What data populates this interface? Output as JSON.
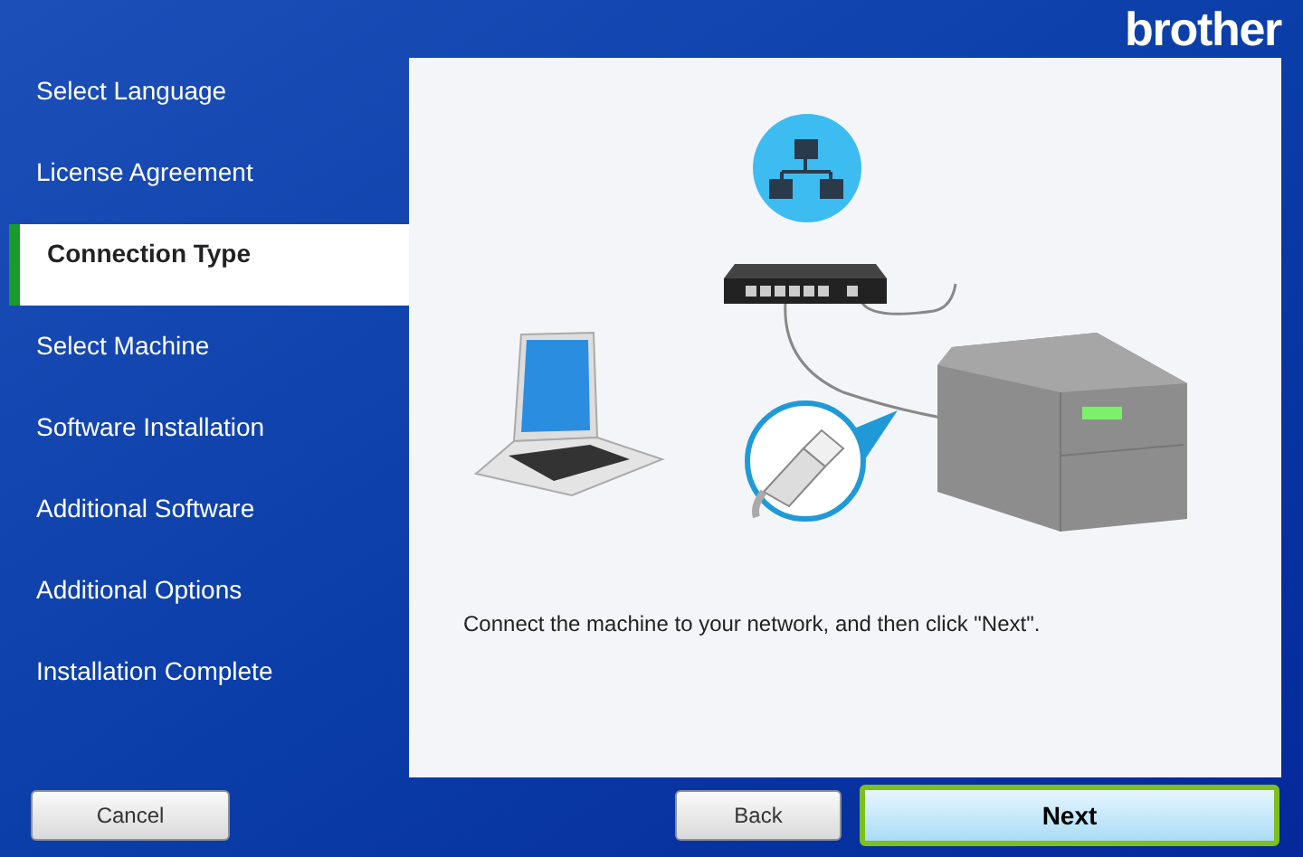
{
  "logo": "brother",
  "steps": [
    {
      "label": "Select Language",
      "selected": false
    },
    {
      "label": "License Agreement",
      "selected": false
    },
    {
      "label": "Connection Type",
      "selected": true
    },
    {
      "label": "Select Machine",
      "selected": false
    },
    {
      "label": "Software Installation",
      "selected": false
    },
    {
      "label": "Additional Software",
      "selected": false
    },
    {
      "label": "Additional Options",
      "selected": false
    },
    {
      "label": "Installation Complete",
      "selected": false
    }
  ],
  "instruction": "Connect the machine to your network, and then click \"Next\".",
  "buttons": [
    {
      "label": "Cancel",
      "kind": "cancel",
      "focused": false
    },
    {
      "label": "Back",
      "kind": "back",
      "focused": false
    },
    {
      "label": "Next",
      "kind": "next",
      "focused": true
    }
  ]
}
